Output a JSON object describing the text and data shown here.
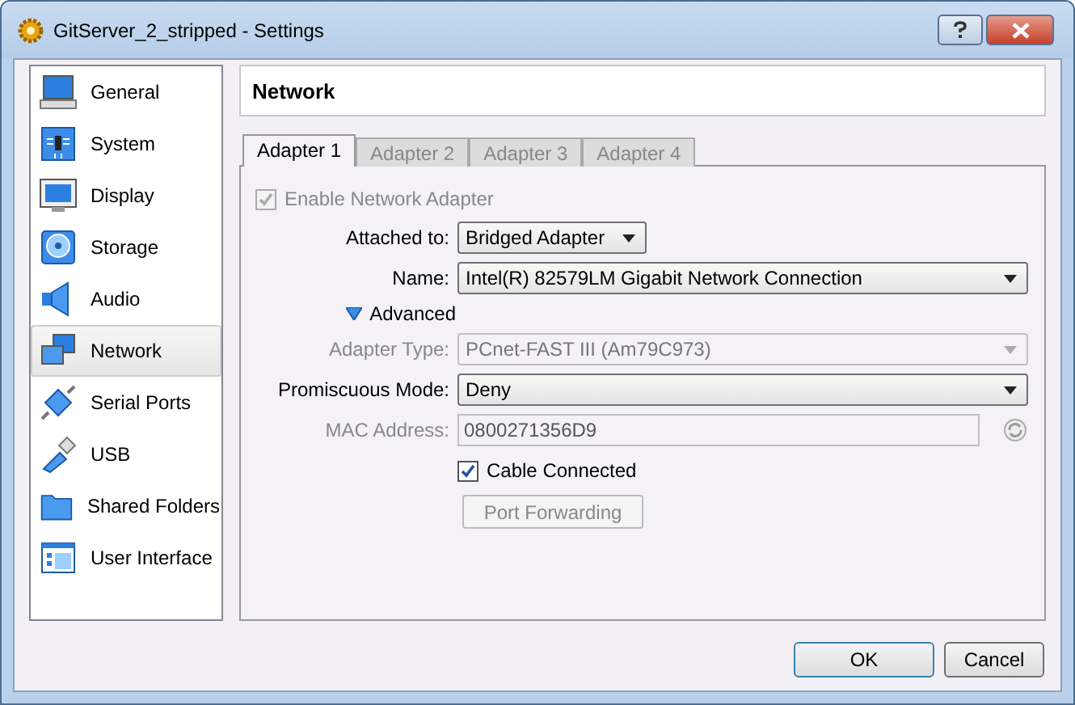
{
  "window": {
    "title": "GitServer_2_stripped - Settings"
  },
  "sidebar": {
    "items": [
      {
        "label": "General",
        "kind": "general",
        "selected": false
      },
      {
        "label": "System",
        "kind": "system",
        "selected": false
      },
      {
        "label": "Display",
        "kind": "display",
        "selected": false
      },
      {
        "label": "Storage",
        "kind": "storage",
        "selected": false
      },
      {
        "label": "Audio",
        "kind": "audio",
        "selected": false
      },
      {
        "label": "Network",
        "kind": "network",
        "selected": true
      },
      {
        "label": "Serial Ports",
        "kind": "serial",
        "selected": false
      },
      {
        "label": "USB",
        "kind": "usb",
        "selected": false
      },
      {
        "label": "Shared Folders",
        "kind": "folder",
        "selected": false
      },
      {
        "label": "User Interface",
        "kind": "ui",
        "selected": false
      }
    ]
  },
  "page_title": "Network",
  "tabs": [
    {
      "label": "Adapter 1",
      "selected": true
    },
    {
      "label": "Adapter 2",
      "selected": false
    },
    {
      "label": "Adapter 3",
      "selected": false
    },
    {
      "label": "Adapter 4",
      "selected": false
    }
  ],
  "enable_adapter": {
    "label": "Enable Network Adapter",
    "checked": true,
    "disabled": true
  },
  "attached_to": {
    "label": "Attached to:",
    "value": "Bridged Adapter"
  },
  "name": {
    "label": "Name:",
    "value": "Intel(R) 82579LM Gigabit Network Connection"
  },
  "advanced": {
    "label": "Advanced",
    "expanded": true
  },
  "adapter_type": {
    "label": "Adapter Type:",
    "value": "PCnet-FAST III (Am79C973)",
    "disabled": true
  },
  "promiscuous_mode": {
    "label": "Promiscuous Mode:",
    "value": "Deny"
  },
  "mac_address": {
    "label": "MAC Address:",
    "value": "0800271356D9",
    "disabled": true
  },
  "cable_connected": {
    "label": "Cable Connected",
    "checked": true
  },
  "port_forwarding": {
    "label": "Port Forwarding",
    "disabled": true
  },
  "buttons": [
    "OK",
    "Cancel"
  ]
}
